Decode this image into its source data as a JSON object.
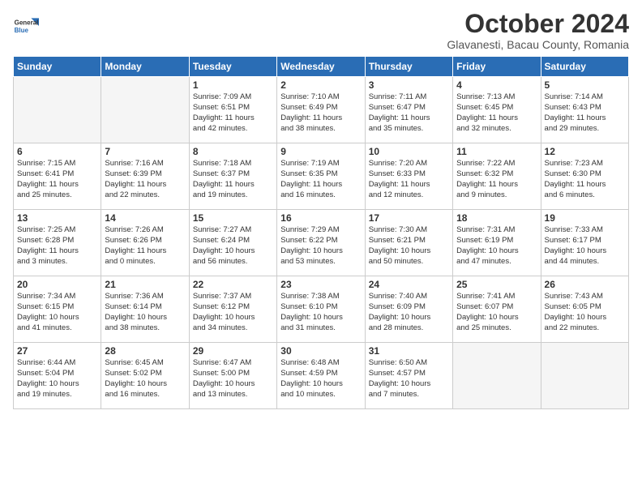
{
  "logo": {
    "general": "General",
    "blue": "Blue"
  },
  "header": {
    "month": "October 2024",
    "location": "Glavanesti, Bacau County, Romania"
  },
  "weekdays": [
    "Sunday",
    "Monday",
    "Tuesday",
    "Wednesday",
    "Thursday",
    "Friday",
    "Saturday"
  ],
  "weeks": [
    [
      {
        "day": "",
        "content": ""
      },
      {
        "day": "",
        "content": ""
      },
      {
        "day": "1",
        "content": "Sunrise: 7:09 AM\nSunset: 6:51 PM\nDaylight: 11 hours\nand 42 minutes."
      },
      {
        "day": "2",
        "content": "Sunrise: 7:10 AM\nSunset: 6:49 PM\nDaylight: 11 hours\nand 38 minutes."
      },
      {
        "day": "3",
        "content": "Sunrise: 7:11 AM\nSunset: 6:47 PM\nDaylight: 11 hours\nand 35 minutes."
      },
      {
        "day": "4",
        "content": "Sunrise: 7:13 AM\nSunset: 6:45 PM\nDaylight: 11 hours\nand 32 minutes."
      },
      {
        "day": "5",
        "content": "Sunrise: 7:14 AM\nSunset: 6:43 PM\nDaylight: 11 hours\nand 29 minutes."
      }
    ],
    [
      {
        "day": "6",
        "content": "Sunrise: 7:15 AM\nSunset: 6:41 PM\nDaylight: 11 hours\nand 25 minutes."
      },
      {
        "day": "7",
        "content": "Sunrise: 7:16 AM\nSunset: 6:39 PM\nDaylight: 11 hours\nand 22 minutes."
      },
      {
        "day": "8",
        "content": "Sunrise: 7:18 AM\nSunset: 6:37 PM\nDaylight: 11 hours\nand 19 minutes."
      },
      {
        "day": "9",
        "content": "Sunrise: 7:19 AM\nSunset: 6:35 PM\nDaylight: 11 hours\nand 16 minutes."
      },
      {
        "day": "10",
        "content": "Sunrise: 7:20 AM\nSunset: 6:33 PM\nDaylight: 11 hours\nand 12 minutes."
      },
      {
        "day": "11",
        "content": "Sunrise: 7:22 AM\nSunset: 6:32 PM\nDaylight: 11 hours\nand 9 minutes."
      },
      {
        "day": "12",
        "content": "Sunrise: 7:23 AM\nSunset: 6:30 PM\nDaylight: 11 hours\nand 6 minutes."
      }
    ],
    [
      {
        "day": "13",
        "content": "Sunrise: 7:25 AM\nSunset: 6:28 PM\nDaylight: 11 hours\nand 3 minutes."
      },
      {
        "day": "14",
        "content": "Sunrise: 7:26 AM\nSunset: 6:26 PM\nDaylight: 11 hours\nand 0 minutes."
      },
      {
        "day": "15",
        "content": "Sunrise: 7:27 AM\nSunset: 6:24 PM\nDaylight: 10 hours\nand 56 minutes."
      },
      {
        "day": "16",
        "content": "Sunrise: 7:29 AM\nSunset: 6:22 PM\nDaylight: 10 hours\nand 53 minutes."
      },
      {
        "day": "17",
        "content": "Sunrise: 7:30 AM\nSunset: 6:21 PM\nDaylight: 10 hours\nand 50 minutes."
      },
      {
        "day": "18",
        "content": "Sunrise: 7:31 AM\nSunset: 6:19 PM\nDaylight: 10 hours\nand 47 minutes."
      },
      {
        "day": "19",
        "content": "Sunrise: 7:33 AM\nSunset: 6:17 PM\nDaylight: 10 hours\nand 44 minutes."
      }
    ],
    [
      {
        "day": "20",
        "content": "Sunrise: 7:34 AM\nSunset: 6:15 PM\nDaylight: 10 hours\nand 41 minutes."
      },
      {
        "day": "21",
        "content": "Sunrise: 7:36 AM\nSunset: 6:14 PM\nDaylight: 10 hours\nand 38 minutes."
      },
      {
        "day": "22",
        "content": "Sunrise: 7:37 AM\nSunset: 6:12 PM\nDaylight: 10 hours\nand 34 minutes."
      },
      {
        "day": "23",
        "content": "Sunrise: 7:38 AM\nSunset: 6:10 PM\nDaylight: 10 hours\nand 31 minutes."
      },
      {
        "day": "24",
        "content": "Sunrise: 7:40 AM\nSunset: 6:09 PM\nDaylight: 10 hours\nand 28 minutes."
      },
      {
        "day": "25",
        "content": "Sunrise: 7:41 AM\nSunset: 6:07 PM\nDaylight: 10 hours\nand 25 minutes."
      },
      {
        "day": "26",
        "content": "Sunrise: 7:43 AM\nSunset: 6:05 PM\nDaylight: 10 hours\nand 22 minutes."
      }
    ],
    [
      {
        "day": "27",
        "content": "Sunrise: 6:44 AM\nSunset: 5:04 PM\nDaylight: 10 hours\nand 19 minutes."
      },
      {
        "day": "28",
        "content": "Sunrise: 6:45 AM\nSunset: 5:02 PM\nDaylight: 10 hours\nand 16 minutes."
      },
      {
        "day": "29",
        "content": "Sunrise: 6:47 AM\nSunset: 5:00 PM\nDaylight: 10 hours\nand 13 minutes."
      },
      {
        "day": "30",
        "content": "Sunrise: 6:48 AM\nSunset: 4:59 PM\nDaylight: 10 hours\nand 10 minutes."
      },
      {
        "day": "31",
        "content": "Sunrise: 6:50 AM\nSunset: 4:57 PM\nDaylight: 10 hours\nand 7 minutes."
      },
      {
        "day": "",
        "content": ""
      },
      {
        "day": "",
        "content": ""
      }
    ]
  ]
}
